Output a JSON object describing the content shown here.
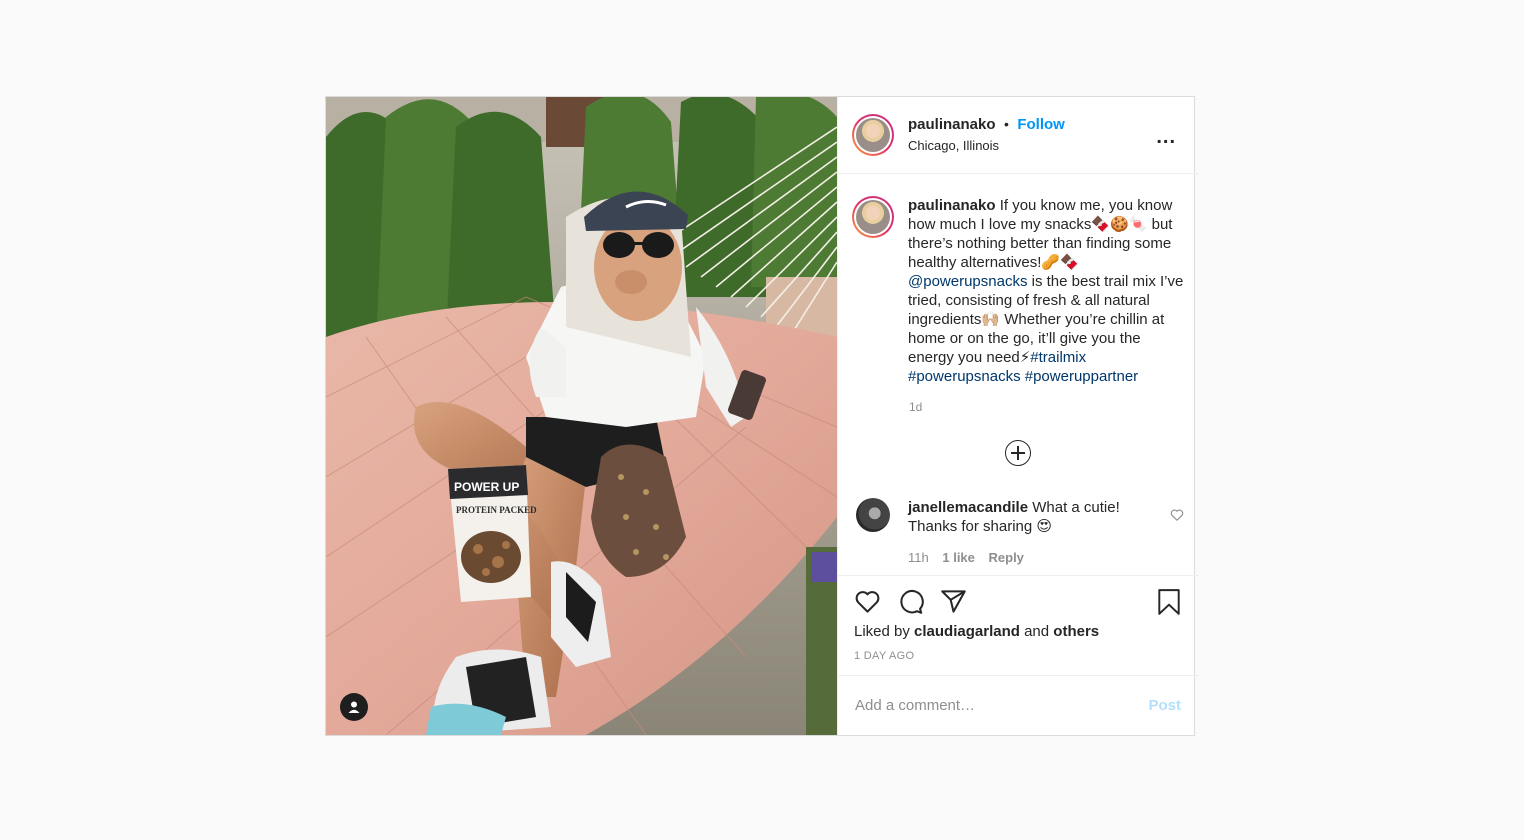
{
  "header": {
    "username": "paulinanako",
    "dot": "•",
    "follow_label": "Follow",
    "location": "Chicago, Illinois",
    "more_label": "..."
  },
  "caption": {
    "username": "paulinanako",
    "text_1": " If you know me, you know how much I love my snacks🍫🍪🍬 but there’s nothing better than finding some healthy alternatives!🥜🍫 ",
    "mention": "@powerupsnacks",
    "text_2": " is the best trail mix I’ve tried, consisting of fresh & all natural ingredients🙌🏼 Whether you’re chillin at home or on the go, it’ll give you the energy you need⚡",
    "tag_1": "#trailmix",
    "tag_2": "#powerupsnacks",
    "tag_3": "#poweruppartner",
    "time": "1d"
  },
  "comment": {
    "username": "janellemacandile",
    "text": " What a cutie! Thanks for sharing 😍",
    "time": "11h",
    "likes": "1 like",
    "reply_label": "Reply"
  },
  "actions": {
    "liked_by_prefix": "Liked by ",
    "liked_by_user": "claudiagarland",
    "liked_and": " and ",
    "liked_others": "others",
    "timestamp": "1 DAY AGO"
  },
  "add_comment": {
    "placeholder": "Add a comment…",
    "post_label": "Post"
  },
  "photo": {
    "snack_bag_brand": "POWER UP",
    "snack_bag_label": "PROTEIN PACKED"
  },
  "colors": {
    "accent": "#0095f6",
    "link": "#00376b",
    "muted": "#8e8e8e",
    "post_disabled": "#b2dffc"
  },
  "icons": [
    "user-tag-icon",
    "more-options-icon",
    "load-more-icon",
    "small-heart-icon",
    "heart-icon",
    "comment-icon",
    "share-icon",
    "bookmark-icon"
  ]
}
